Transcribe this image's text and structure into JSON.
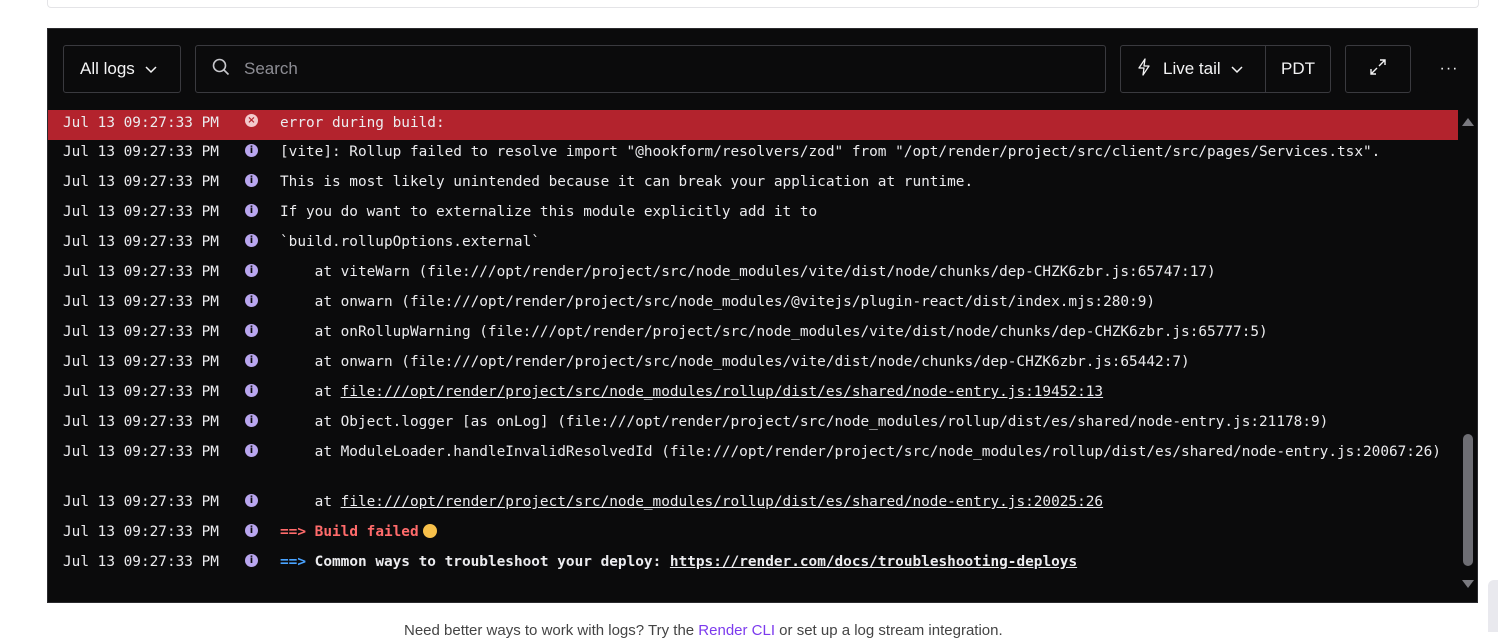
{
  "toolbar": {
    "filter_label": "All logs",
    "search_placeholder": "Search",
    "live_tail_label": "Live tail",
    "timezone_label": "PDT",
    "more_label": "···"
  },
  "logs": [
    {
      "ts": "Jul 13 09:27:33 PM",
      "level": "error",
      "msg": "error during build:"
    },
    {
      "ts": "Jul 13 09:27:33 PM",
      "level": "info",
      "msg": "[vite]: Rollup failed to resolve import \"@hookform/resolvers/zod\" from \"/opt/render/project/src/client/src/pages/Services.tsx\"."
    },
    {
      "ts": "Jul 13 09:27:33 PM",
      "level": "info",
      "msg": "This is most likely unintended because it can break your application at runtime."
    },
    {
      "ts": "Jul 13 09:27:33 PM",
      "level": "info",
      "msg": "If you do want to externalize this module explicitly add it to"
    },
    {
      "ts": "Jul 13 09:27:33 PM",
      "level": "info",
      "msg": "`build.rollupOptions.external`"
    },
    {
      "ts": "Jul 13 09:27:33 PM",
      "level": "info",
      "msg": "    at viteWarn (file:///opt/render/project/src/node_modules/vite/dist/node/chunks/dep-CHZK6zbr.js:65747:17)"
    },
    {
      "ts": "Jul 13 09:27:33 PM",
      "level": "info",
      "msg": "    at onwarn (file:///opt/render/project/src/node_modules/@vitejs/plugin-react/dist/index.mjs:280:9)"
    },
    {
      "ts": "Jul 13 09:27:33 PM",
      "level": "info",
      "msg": "    at onRollupWarning (file:///opt/render/project/src/node_modules/vite/dist/node/chunks/dep-CHZK6zbr.js:65777:5)"
    },
    {
      "ts": "Jul 13 09:27:33 PM",
      "level": "info",
      "msg": "    at onwarn (file:///opt/render/project/src/node_modules/vite/dist/node/chunks/dep-CHZK6zbr.js:65442:7)"
    },
    {
      "ts": "Jul 13 09:27:33 PM",
      "level": "info",
      "msg_prefix": "    at ",
      "link": "file:///opt/render/project/src/node_modules/rollup/dist/es/shared/node-entry.js:19452:13"
    },
    {
      "ts": "Jul 13 09:27:33 PM",
      "level": "info",
      "msg": "    at Object.logger [as onLog] (file:///opt/render/project/src/node_modules/rollup/dist/es/shared/node-entry.js:21178:9)"
    },
    {
      "ts": "Jul 13 09:27:33 PM",
      "level": "info",
      "msg": "    at ModuleLoader.handleInvalidResolvedId (file:///opt/render/project/src/node_modules/rollup/dist/es/shared/node-entry.js:20067:26)"
    },
    {
      "ts": "Jul 13 09:27:33 PM",
      "level": "info",
      "msg_prefix": "    at ",
      "link": "file:///opt/render/project/src/node_modules/rollup/dist/es/shared/node-entry.js:20025:26"
    },
    {
      "ts": "Jul 13 09:27:33 PM",
      "level": "info",
      "arrow": "==>",
      "bold_text": "Build failed"
    },
    {
      "ts": "Jul 13 09:27:33 PM",
      "level": "info",
      "arrow": "==>",
      "bold_text": "Common ways to troubleshoot your deploy: ",
      "link": "https://render.com/docs/troubleshooting-deploys"
    }
  ],
  "footer": {
    "text": "Need better ways to work with logs? Try the ",
    "link": "Render CLI",
    "rest": " or set up a log stream integration."
  },
  "colors": {
    "error_row": "#b3232d",
    "info_icon": "#b9a6ef",
    "build_failed": "#ff6b6b",
    "arrow_blue": "#4aa3ff"
  }
}
